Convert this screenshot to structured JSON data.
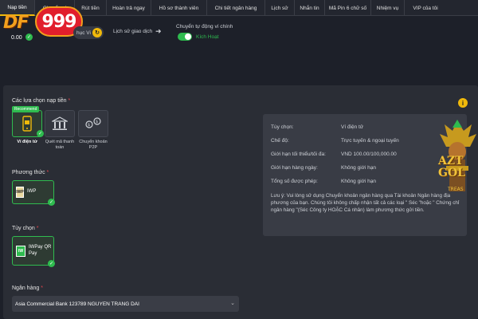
{
  "tabs": [
    {
      "label": "Nạp tiền",
      "active": true
    },
    {
      "label": "Chuyển ví",
      "active": false
    },
    {
      "label": "Rút tiền",
      "active": false
    },
    {
      "label": "Hoàn trả ngay",
      "active": false
    },
    {
      "label": "Hồ sơ thành viên",
      "active": false
    },
    {
      "label": "Chi tiết ngân hàng",
      "active": false
    },
    {
      "label": "Lịch sử",
      "active": false
    },
    {
      "label": "Nhắn tin",
      "active": false
    },
    {
      "label": "Mã Pin 6 chữ số",
      "active": false
    },
    {
      "label": "Nhiệm vụ",
      "active": false
    },
    {
      "label": "VIP của tôi",
      "active": false
    }
  ],
  "logo": {
    "left": "DF",
    "right": "999"
  },
  "wallet": {
    "balance": "0.00",
    "recover_label": "hục Vi",
    "history_link": "Lịch sử giao dịch",
    "auto_transfer_label": "Chuyển tự động ví chính",
    "auto_transfer_status": "Kích Hoạt",
    "auto_transfer_on": true
  },
  "deposit": {
    "options_title": "Các lựa chọn nạp tiền",
    "recommend_badge": "Recommend",
    "options": [
      {
        "label": "Ví điện tử",
        "selected": true,
        "icon": "mobile-wallet-icon"
      },
      {
        "label": "Quét mã thanh toán",
        "selected": false,
        "icon": "bank-building-icon"
      },
      {
        "label": "Chuyển khoản P2P",
        "selected": false,
        "icon": "p2p-transfer-icon"
      }
    ],
    "method_title": "Phương thức",
    "method": {
      "label": "IWP",
      "logo": "IWP"
    },
    "choice_title": "Tùy chọn",
    "choice": {
      "label": "IWPay QR Pay",
      "logo": "IW"
    },
    "bank_title": "Ngân hàng",
    "bank_value": "Asia Commercial Bank 123789 NGUYEN TRANG DAI"
  },
  "info": {
    "rows": [
      {
        "label": "Tùy chọn:",
        "value": "Ví điện tử"
      },
      {
        "label": "Chế độ:",
        "value": "Trực tuyến & ngoại tuyến"
      },
      {
        "label": "Giới hạn tối thiểu/tối đa:",
        "value": "VND 100.00/100,000.00"
      },
      {
        "label": "Giới hạn hàng ngày:",
        "value": "Không giới hạn"
      },
      {
        "label": "Tổng số được phép:",
        "value": "Không giới hạn"
      }
    ],
    "note": "Lưu ý: Vui lòng sử dụng Chuyển khoản ngân hàng qua Tài khoản Ngân hàng địa phương của bạn. Chúng tôi không chấp nhận tất cả các loại \" Séc \"hoặc \" Chứng chỉ ngân hàng \"(Séc Công ty HOẶC Cá nhân) làm phương thức gửi tiền."
  },
  "promo": {
    "line1": "AZT",
    "line2": "GOL",
    "line3": "TREAS"
  },
  "colors": {
    "accent_green": "#2fbb4f",
    "accent_gold": "#f0b90b",
    "background": "#1d2029"
  }
}
